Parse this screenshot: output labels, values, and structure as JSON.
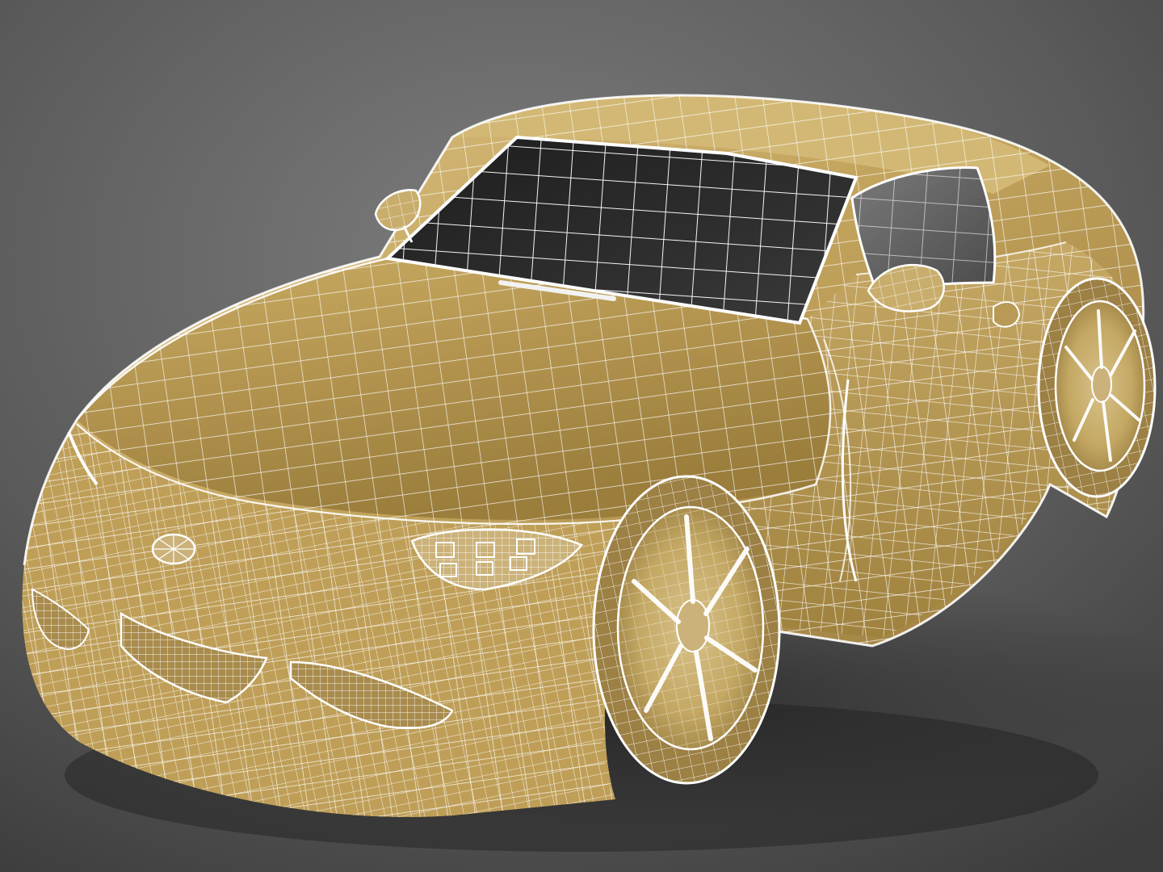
{
  "scene": {
    "subject": "sports-car-wireframe",
    "palette": {
      "background_top": "#7a7a7a",
      "background_bottom": "#3a3a3a",
      "body_light": "#d7bd7c",
      "body_mid": "#b99a55",
      "body_dark": "#8a6d32",
      "wire": "#ffffff",
      "glass": "#2a2a2a",
      "glass_side": "#5e5e5e",
      "tire": "#c9b27a"
    }
  }
}
